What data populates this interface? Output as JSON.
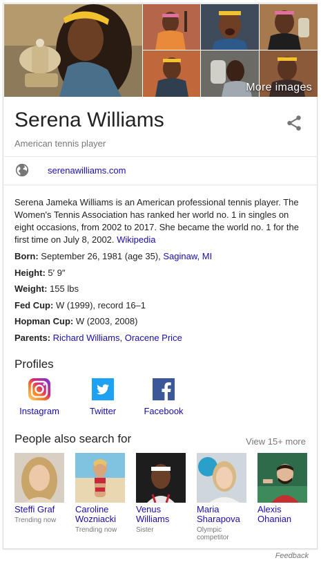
{
  "mosaic": {
    "more_images_label": "More images"
  },
  "entity": {
    "name": "Serena Williams",
    "subtitle": "American tennis player",
    "website": "serenawilliams.com",
    "description": "Serena Jameka Williams is an American professional tennis player. The Women's Tennis Association has ranked her world no. 1 in singles on eight occasions, from 2002 to 2017. She became the world no. 1 for the first time on July 8, 2002.",
    "description_source": "Wikipedia"
  },
  "facts": {
    "born": {
      "label": "Born:",
      "value": "September 26, 1981 (age 35),",
      "link": "Saginaw, MI"
    },
    "height": {
      "label": "Height:",
      "value": "5′ 9″"
    },
    "weight": {
      "label": "Weight:",
      "value": "155 lbs"
    },
    "fed_cup": {
      "label": "Fed Cup:",
      "value": "W (1999), record 16–1"
    },
    "hopman_cup": {
      "label": "Hopman Cup:",
      "value": "W (2003, 2008)"
    },
    "parents": {
      "label": "Parents:",
      "link1": "Richard Williams",
      "sep": ",",
      "link2": "Oracene Price"
    }
  },
  "profiles": {
    "title": "Profiles",
    "items": [
      {
        "label": "Instagram",
        "icon": "instagram-icon",
        "color": "#c13584"
      },
      {
        "label": "Twitter",
        "icon": "twitter-icon",
        "color": "#1da1f2"
      },
      {
        "label": "Facebook",
        "icon": "facebook-icon",
        "color": "#3b5998"
      }
    ]
  },
  "people": {
    "title": "People also search for",
    "view_more": "View 15+ more",
    "items": [
      {
        "name_line1": "Steffi Graf",
        "name_line2": "",
        "meta_line1": "Trending now",
        "meta_line2": ""
      },
      {
        "name_line1": "Caroline",
        "name_line2": "Wozniacki",
        "meta_line1": "Trending now",
        "meta_line2": ""
      },
      {
        "name_line1": "Venus",
        "name_line2": "Williams",
        "meta_line1": "Sister",
        "meta_line2": ""
      },
      {
        "name_line1": "Maria",
        "name_line2": "Sharapova",
        "meta_line1": "Olympic",
        "meta_line2": "competitor"
      },
      {
        "name_line1": "Alexis",
        "name_line2": "Ohanian",
        "meta_line1": "",
        "meta_line2": ""
      }
    ]
  },
  "footer": {
    "feedback": "Feedback"
  },
  "colors": {
    "link": "#1a0dab",
    "muted": "#777777",
    "headband": "#f2c12e"
  }
}
